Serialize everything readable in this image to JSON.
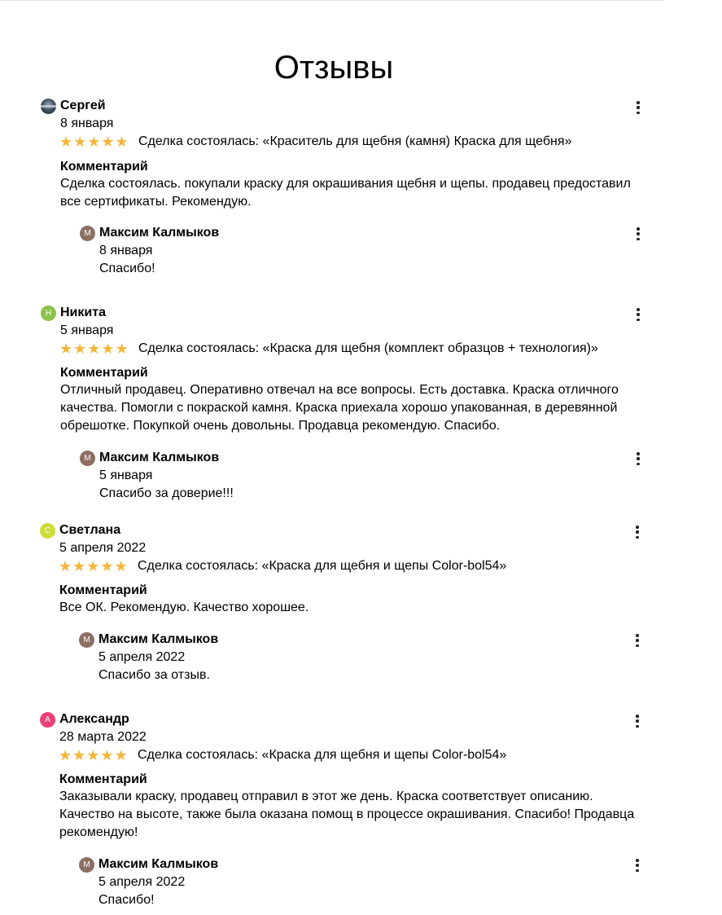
{
  "page": {
    "title": "Отзывы"
  },
  "reviews": [
    {
      "author": "Сергей",
      "avatar_letter": "",
      "avatar_color": "#3a4a55",
      "date": "8 января",
      "stars": "★★★★★",
      "deal": "Сделка состоялась: «Краситель для щебня (камня) Краска для щебня»",
      "comment_label": "Комментарий",
      "comment": "Сделка состоялась. покупали краску для окрашивания щебня и щепы. продавец предоставил все сертификаты. Рекомендую.",
      "reply": {
        "author": "Максим Калмыков",
        "avatar_letter": "М",
        "avatar_color": "#8d6e63",
        "date": "8 января",
        "text": "Спасибо!"
      }
    },
    {
      "author": "Никита",
      "avatar_letter": "Н",
      "avatar_color": "#8bc34a",
      "date": "5 января",
      "stars": "★★★★★",
      "deal": "Сделка состоялась: «Краска для щебня (комплект образцов + технология)»",
      "comment_label": "Комментарий",
      "comment": "Отличный продавец. Оперативно отвечал на все вопросы. Есть доставка. Краска отличного качества. Помогли с покраской камня. Краска приехала хорошо упакованная, в деревянной обрешотке. Покупкой очень довольны. Продавца рекомендую. Спасибо.",
      "reply": {
        "author": "Максим Калмыков",
        "avatar_letter": "М",
        "avatar_color": "#8d6e63",
        "date": "5 января",
        "text": "Спасибо за доверие!!!"
      }
    },
    {
      "author": "Светлана",
      "avatar_letter": "С",
      "avatar_color": "#cddc39",
      "date": "5 апреля 2022",
      "stars": "★★★★★",
      "deal": "Сделка состоялась: «Краска для щебня и щепы Color-bol54»",
      "comment_label": "Комментарий",
      "comment": "Все ОК. Рекомендую. Качество хорошее.",
      "reply": {
        "author": "Максим Калмыков",
        "avatar_letter": "М",
        "avatar_color": "#8d6e63",
        "date": "5 апреля 2022",
        "text": "Спасибо за отзыв."
      }
    },
    {
      "author": "Александр",
      "avatar_letter": "А",
      "avatar_color": "#ec407a",
      "date": "28 марта 2022",
      "stars": "★★★★★",
      "deal": "Сделка состоялась: «Краска для щебня и щепы Color-bol54»",
      "comment_label": "Комментарий",
      "comment": "Заказывали краску, продавец отправил в этот же день. Краска соответствует описанию. Качество на высоте, также была оказана помощ в процессе окрашивания. Спасибо! Продавца рекомендую!",
      "reply": {
        "author": "Максим Калмыков",
        "avatar_letter": "М",
        "avatar_color": "#8d6e63",
        "date": "5 апреля 2022",
        "text": "Спасибо!"
      }
    }
  ]
}
